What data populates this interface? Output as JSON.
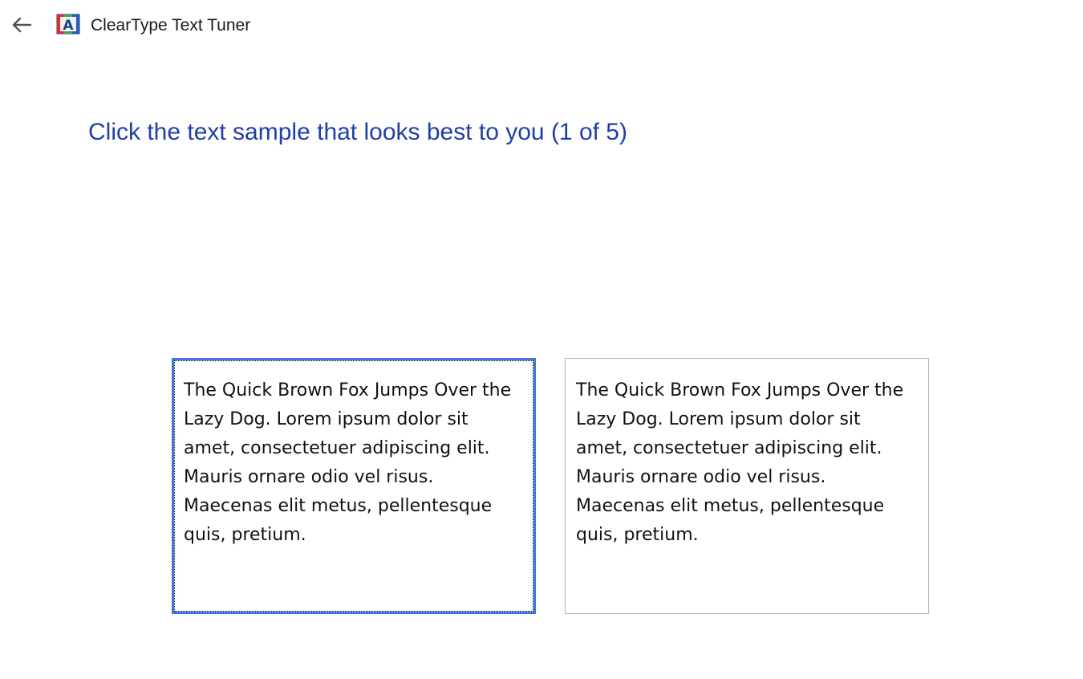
{
  "window": {
    "title": "ClearType Text Tuner",
    "icon": "cleartype-app-icon",
    "back_icon": "back-arrow-icon"
  },
  "main": {
    "instruction": "Click the text sample that looks best to you (1 of 5)",
    "samples": [
      {
        "text": "The Quick Brown Fox Jumps Over the Lazy Dog. Lorem ipsum dolor sit amet, consectetuer adipiscing elit. Mauris ornare odio vel risus. Maecenas elit metus, pellentesque quis, pretium.",
        "selected": true
      },
      {
        "text": "The Quick Brown Fox Jumps Over the Lazy Dog. Lorem ipsum dolor sit amet, consectetuer adipiscing elit. Mauris ornare odio vel risus. Maecenas elit metus, pellentesque quis, pretium.",
        "selected": false
      }
    ]
  },
  "colors": {
    "instruction_text": "#1f3fa8",
    "selected_border": "#3b78d8",
    "unselected_border": "#b5b5b5"
  }
}
